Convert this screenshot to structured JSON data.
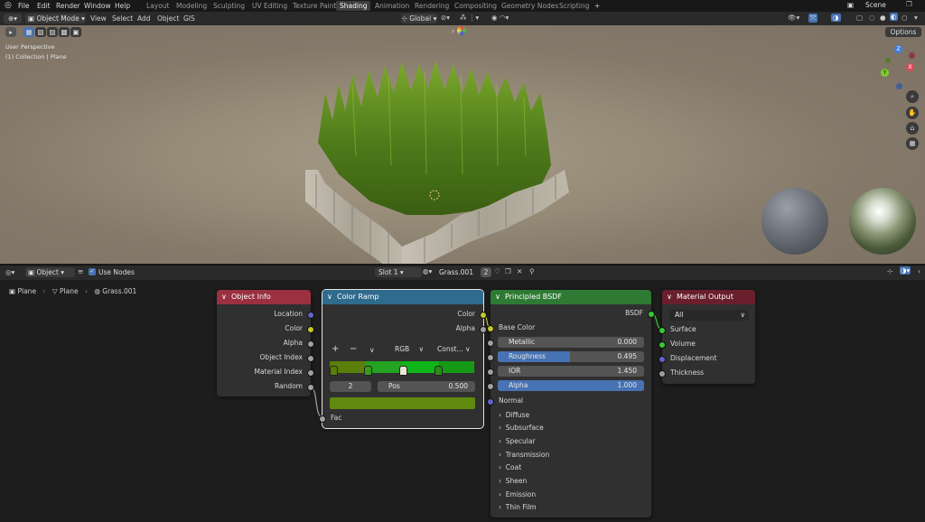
{
  "topbar": {
    "menus": [
      "File",
      "Edit",
      "Render",
      "Window",
      "Help"
    ],
    "workspaces": [
      "Layout",
      "Modeling",
      "Sculpting",
      "UV Editing",
      "Texture Paint",
      "Shading",
      "Animation",
      "Rendering",
      "Compositing",
      "Geometry Nodes",
      "Scripting"
    ],
    "active_workspace": "Shading",
    "add_tab": "+",
    "scene": "Scene"
  },
  "viewport_header": {
    "mode": "Object Mode",
    "menus": [
      "View",
      "Select",
      "Add",
      "Object",
      "GIS"
    ],
    "transform": "Global",
    "options": "Options"
  },
  "viewport": {
    "perspective": "User Perspective",
    "collection": "(1) Collection | Plane",
    "gizmo": {
      "x": "X",
      "y": "Y",
      "z": "Z"
    }
  },
  "node_header": {
    "editor_type": "Object",
    "use_nodes": "Use Nodes",
    "slot": "Slot 1",
    "material": "Grass.001",
    "users": "2"
  },
  "breadcrumb": {
    "object": "Plane",
    "mesh": "Plane",
    "material": "Grass.001"
  },
  "nodes": {
    "object_info": {
      "title": "Object Info",
      "outputs": [
        "Location",
        "Color",
        "Alpha",
        "Object Index",
        "Material Index",
        "Random"
      ]
    },
    "color_ramp": {
      "title": "Color Ramp",
      "outputs": [
        "Color",
        "Alpha"
      ],
      "add": "+",
      "remove": "−",
      "menu": "∨",
      "color_mode": "RGB",
      "interpolation": "Const...",
      "index": "2",
      "pos_label": "Pos",
      "pos_value": "0.500",
      "input": "Fac"
    },
    "principled": {
      "title": "Principled BSDF",
      "output": "BSDF",
      "base_color": "Base Color",
      "metallic": {
        "label": "Metallic",
        "value": "0.000",
        "fraction": 0
      },
      "roughness": {
        "label": "Roughness",
        "value": "0.495",
        "fraction": 0.495
      },
      "ior": {
        "label": "IOR",
        "value": "1.450"
      },
      "alpha": {
        "label": "Alpha",
        "value": "1.000",
        "fraction": 1
      },
      "normal": "Normal",
      "panels": [
        "Diffuse",
        "Subsurface",
        "Specular",
        "Transmission",
        "Coat",
        "Sheen",
        "Emission",
        "Thin Film"
      ]
    },
    "material_output": {
      "title": "Material Output",
      "target": "All",
      "inputs": [
        "Surface",
        "Volume",
        "Displacement",
        "Thickness"
      ]
    }
  },
  "colors": {
    "object_info_header": "#9a3040",
    "color_ramp_header": "#2f6b8c",
    "principled_header": "#2e7a35",
    "material_output_header": "#6a1f2d",
    "socket_color": "#c7c729",
    "socket_float": "#a1a1a1",
    "socket_vector": "#6363c7",
    "socket_shader": "#39c739",
    "ramp_bar": "#6b8f10",
    "active_blue": "#4772b3"
  }
}
